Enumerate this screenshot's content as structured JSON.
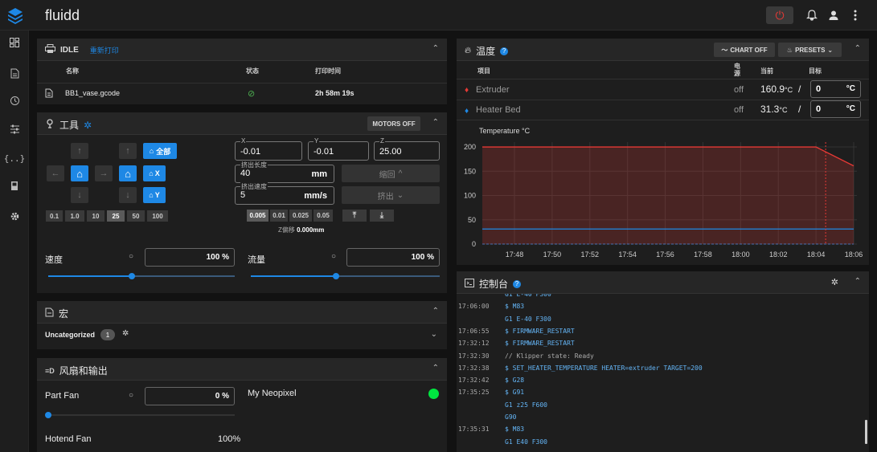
{
  "app": {
    "title": "fluidd"
  },
  "job": {
    "status": "IDLE",
    "reprint": "重新打印",
    "col_name": "名称",
    "col_status": "状态",
    "col_time": "打印时间",
    "file_name": "BB1_vase.gcode",
    "file_time": "2h 58m 19s"
  },
  "tools": {
    "title": "工具",
    "motors_off": "MOTORS OFF",
    "home_all": "全部",
    "home_x": "X",
    "home_y": "Y",
    "steps": [
      "0.1",
      "1.0",
      "10",
      "25",
      "50",
      "100"
    ],
    "x_label": "X",
    "x_val": "-0.01",
    "y_label": "Y",
    "y_val": "-0.01",
    "z_label": "Z",
    "z_val": "25.00",
    "extrude_len_label": "挤出长度",
    "extrude_len_val": "40",
    "extrude_len_unit": "mm",
    "extrude_speed_label": "挤出速度",
    "extrude_speed_val": "5",
    "extrude_speed_unit": "mm/s",
    "retract": "缩回",
    "extrude": "挤出",
    "z_steps": [
      "0.005",
      "0.01",
      "0.025",
      "0.05"
    ],
    "z_offset_label": "Z偏移",
    "z_offset_val": "0.000mm",
    "speed_label": "速度",
    "speed_val": "100",
    "speed_unit": "%",
    "flow_label": "流量",
    "flow_val": "100",
    "flow_unit": "%",
    "speed_fraction": 0.45,
    "flow_fraction": 0.45
  },
  "macros": {
    "title": "宏",
    "group": "Uncategorized",
    "count": "1"
  },
  "fans": {
    "title": "风扇和输出",
    "part_fan": "Part Fan",
    "part_fan_val": "0",
    "part_fan_unit": "%",
    "neopixel": "My Neopixel",
    "hotend_fan": "Hotend Fan",
    "hotend_fan_val": "100%",
    "part_fan_fraction": 0
  },
  "temps": {
    "title": "温度",
    "chart_off": "CHART OFF",
    "presets": "PRESETS",
    "col_item": "项目",
    "col_power": "电源",
    "col_current": "当前",
    "col_target": "目标",
    "rows": [
      {
        "name": "Extruder",
        "power": "off",
        "current": "160.9",
        "unit": "°C",
        "slash": "/",
        "target": "0",
        "target_unit": "°C"
      },
      {
        "name": "Heater Bed",
        "power": "off",
        "current": "31.3",
        "unit": "°C",
        "slash": "/",
        "target": "0",
        "target_unit": "°C"
      }
    ]
  },
  "chart_data": {
    "type": "line",
    "title": "",
    "ylabel": "Temperature °C",
    "xlabel": "",
    "x": [
      "17:48",
      "17:50",
      "17:52",
      "17:54",
      "17:56",
      "17:58",
      "18:00",
      "18:02",
      "18:04",
      "18:06"
    ],
    "yticks": [
      0,
      50,
      100,
      150,
      200
    ],
    "ylim": [
      0,
      210
    ],
    "series": [
      {
        "name": "Extruder",
        "color": "#e53935",
        "values": [
          200,
          200,
          200,
          200,
          200,
          200,
          200,
          200,
          200,
          161
        ]
      },
      {
        "name": "Extruder target",
        "color": "#e53935",
        "values": [
          0,
          0,
          0,
          0,
          0,
          0,
          0,
          0,
          0,
          0
        ]
      },
      {
        "name": "Heater Bed",
        "color": "#1e88e5",
        "values": [
          31,
          31,
          31,
          31,
          31,
          31,
          31,
          31,
          31,
          31
        ]
      },
      {
        "name": "Heater Bed target",
        "color": "#1e88e5",
        "values": [
          0,
          0,
          0,
          0,
          0,
          0,
          0,
          0,
          0,
          0
        ]
      }
    ],
    "grid": true
  },
  "console": {
    "title": "控制台",
    "lines": [
      {
        "time": "",
        "text": "G1 E-40 F300",
        "color": "#64b5f6"
      },
      {
        "time": "17:06:00",
        "text": "$ M83",
        "color": "#64b5f6"
      },
      {
        "time": "",
        "text": "G1 E-40 F300",
        "color": "#64b5f6"
      },
      {
        "time": "17:06:55",
        "text": "$ FIRMWARE_RESTART",
        "color": "#64b5f6"
      },
      {
        "time": "17:32:12",
        "text": "$ FIRMWARE_RESTART",
        "color": "#64b5f6"
      },
      {
        "time": "17:32:30",
        "text": "// Klipper state: Ready",
        "color": "#aaaaaa"
      },
      {
        "time": "17:32:38",
        "text": "$ SET_HEATER_TEMPERATURE HEATER=extruder TARGET=200",
        "color": "#64b5f6"
      },
      {
        "time": "17:32:42",
        "text": "$ G28",
        "color": "#64b5f6"
      },
      {
        "time": "17:35:25",
        "text": "$ G91",
        "color": "#64b5f6"
      },
      {
        "time": "",
        "text": "G1 z25 F600",
        "color": "#64b5f6"
      },
      {
        "time": "",
        "text": "G90",
        "color": "#64b5f6"
      },
      {
        "time": "17:35:31",
        "text": "$ M83",
        "color": "#64b5f6"
      },
      {
        "time": "",
        "text": "G1 E40 F300",
        "color": "#64b5f6"
      }
    ]
  }
}
